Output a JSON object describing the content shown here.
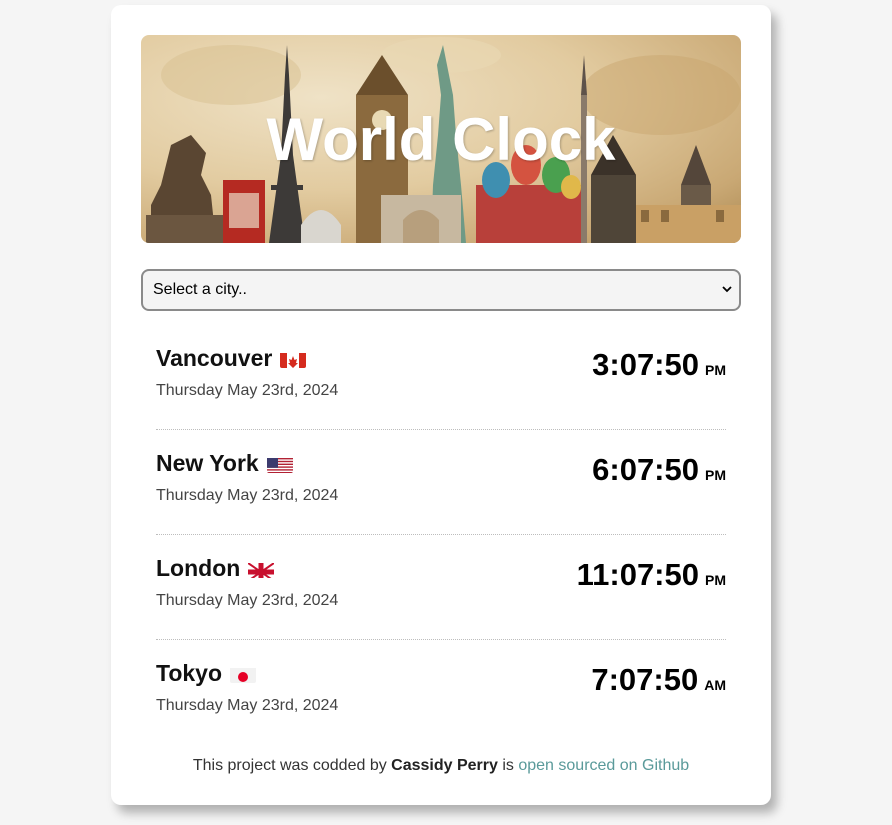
{
  "header": {
    "title": "World Clock"
  },
  "select": {
    "value": "Select a city.."
  },
  "cities": [
    {
      "name": "Vancouver",
      "flag": "canada-flag-icon",
      "date": "Thursday May 23rd, 2024",
      "time": "3:07:50",
      "ampm": "PM"
    },
    {
      "name": "New York",
      "flag": "usa-flag-icon",
      "date": "Thursday May 23rd, 2024",
      "time": "6:07:50",
      "ampm": "PM"
    },
    {
      "name": "London",
      "flag": "uk-flag-icon",
      "date": "Thursday May 23rd, 2024",
      "time": "11:07:50",
      "ampm": "PM"
    },
    {
      "name": "Tokyo",
      "flag": "japan-flag-icon",
      "date": "Thursday May 23rd, 2024",
      "time": "7:07:50",
      "ampm": "AM"
    }
  ],
  "footer": {
    "prefix": "This project was codded by ",
    "author": "Cassidy Perry",
    "middle": " is ",
    "link_text": "open sourced on Github"
  }
}
